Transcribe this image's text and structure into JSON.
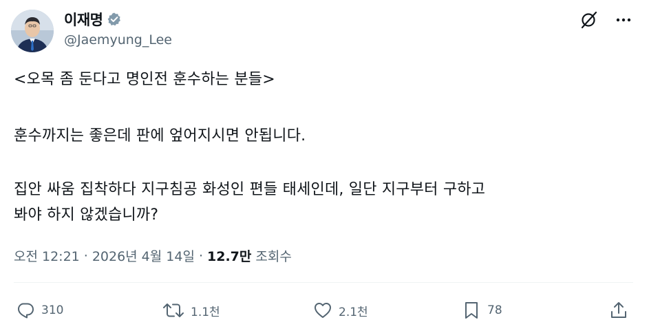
{
  "author": {
    "display_name": "이재명",
    "handle": "@Jaemyung_Lee",
    "verified": true,
    "verified_color": "#829aab"
  },
  "header_icons": [
    "grok-icon",
    "more-icon"
  ],
  "tweet": {
    "lines": [
      "<오목 좀 둔다고 명인전 훈수하는 분들>",
      "훈수까지는 좋은데 판에 엎어지시면 안됩니다.",
      "집안 싸움 집착하다 지구침공 화성인 편들 태세인데, 일단 지구부터 구하고",
      "봐야 하지 않겠습니까?"
    ]
  },
  "meta": {
    "time": "오전 12:21",
    "separator": "·",
    "date": "2026년 4월 14일",
    "views_count": "12.7만",
    "views_label": "조회수"
  },
  "actions": {
    "reply_count": "310",
    "retweet_count": "1.1천",
    "like_count": "2.1천",
    "bookmark_count": "78"
  },
  "colors": {
    "text_primary": "#0f1419",
    "text_secondary": "#536471",
    "divider": "#eff3f4"
  }
}
